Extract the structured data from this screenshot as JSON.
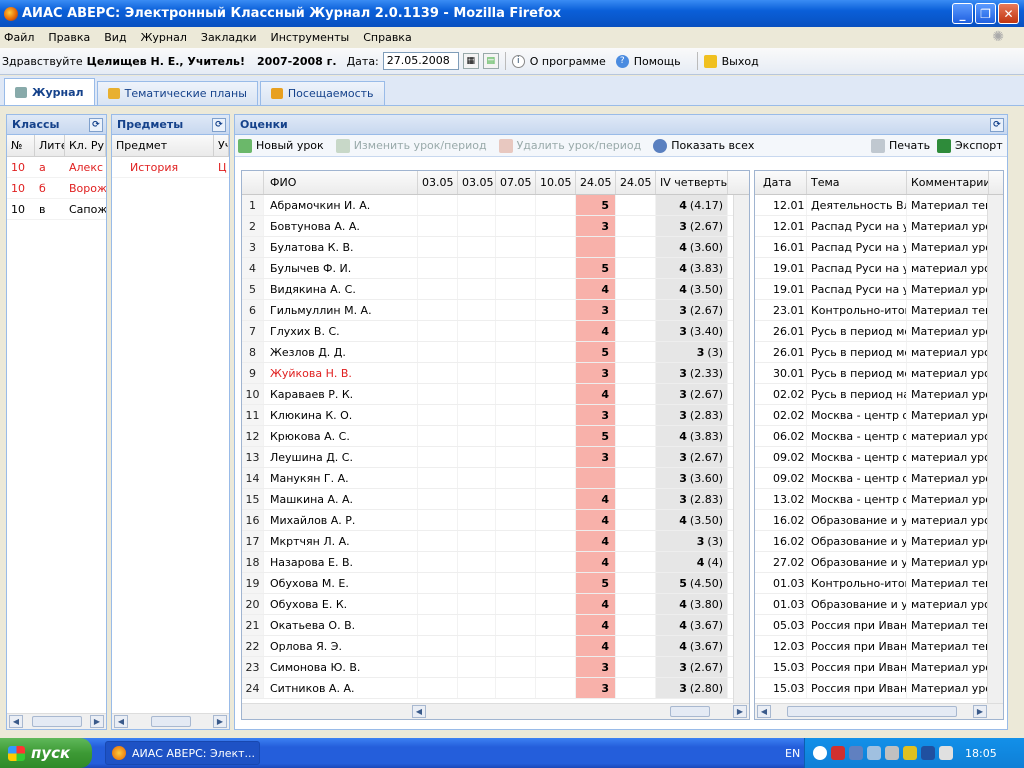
{
  "window": {
    "title": "АИАС АВЕРС: Электронный Классный Журнал 2.0.1139 - Mozilla Firefox"
  },
  "menu": [
    "Файл",
    "Правка",
    "Вид",
    "Журнал",
    "Закладки",
    "Инструменты",
    "Справка"
  ],
  "appbar": {
    "greeting": "Здравствуйте",
    "user": "Целищев Н. Е., Учитель!",
    "year": "2007-2008 г.",
    "date_label": "Дата:",
    "date_value": "27.05.2008",
    "about": "О программе",
    "help": "Помощь",
    "exit": "Выход"
  },
  "tabs": [
    "Журнал",
    "Тематические планы",
    "Посещаемость"
  ],
  "classes": {
    "title": "Классы",
    "headers": [
      "№",
      "Лите",
      "Кл. Ру"
    ],
    "rows": [
      [
        "10",
        "а",
        "Алекс"
      ],
      [
        "10",
        "б",
        "Ворож"
      ],
      [
        "10",
        "в",
        "Сапож"
      ]
    ]
  },
  "subjects": {
    "title": "Предметы",
    "headers": [
      "Предмет",
      "Уч"
    ],
    "rows": [
      [
        "История",
        "Ц"
      ]
    ]
  },
  "grades": {
    "title": "Оценки",
    "toolbar": {
      "new_lesson": "Новый урок",
      "edit_lesson": "Изменить урок/период",
      "delete_lesson": "Удалить урок/период",
      "show_all": "Показать всех",
      "print": "Печать",
      "export": "Экспорт"
    },
    "headers": [
      "ФИО",
      "03.05",
      "03.05",
      "07.05",
      "10.05",
      "24.05",
      "24.05",
      "IV четверть"
    ],
    "rows": [
      [
        "1",
        "Абрамочкин И. А.",
        "5",
        "4",
        "(4.17)"
      ],
      [
        "2",
        "Бовтунова А. А.",
        "3",
        "3",
        "(2.67)"
      ],
      [
        "3",
        "Булатова К. В.",
        "",
        "4",
        "(3.60)"
      ],
      [
        "4",
        "Булычев Ф. И.",
        "5",
        "4",
        "(3.83)"
      ],
      [
        "5",
        "Видякина А. С.",
        "4",
        "4",
        "(3.50)"
      ],
      [
        "6",
        "Гильмуллин М. А.",
        "3",
        "3",
        "(2.67)"
      ],
      [
        "7",
        "Глухих В. С.",
        "4",
        "3",
        "(3.40)"
      ],
      [
        "8",
        "Жезлов Д. Д.",
        "5",
        "3",
        "(3)"
      ],
      [
        "9",
        "Жуйкова Н. В.",
        "3",
        "3",
        "(2.33)"
      ],
      [
        "10",
        "Караваев Р. К.",
        "4",
        "3",
        "(2.67)"
      ],
      [
        "11",
        "Клюкина К. О.",
        "3",
        "3",
        "(2.83)"
      ],
      [
        "12",
        "Крюкова А. С.",
        "5",
        "4",
        "(3.83)"
      ],
      [
        "13",
        "Леушина Д. С.",
        "3",
        "3",
        "(2.67)"
      ],
      [
        "14",
        "Манукян Г. А.",
        "",
        "3",
        "(3.60)"
      ],
      [
        "15",
        "Машкина А. А.",
        "4",
        "3",
        "(2.83)"
      ],
      [
        "16",
        "Михайлов А. Р.",
        "4",
        "4",
        "(3.50)"
      ],
      [
        "17",
        "Мкртчян Л. А.",
        "4",
        "3",
        "(3)"
      ],
      [
        "18",
        "Назарова Е. В.",
        "4",
        "4",
        "(4)"
      ],
      [
        "19",
        "Обухова М. Е.",
        "5",
        "5",
        "(4.50)"
      ],
      [
        "20",
        "Обухова Е. К.",
        "4",
        "4",
        "(3.80)"
      ],
      [
        "21",
        "Окатьева О. В.",
        "4",
        "4",
        "(3.67)"
      ],
      [
        "22",
        "Орлова Я. Э.",
        "4",
        "4",
        "(3.67)"
      ],
      [
        "23",
        "Симонова Ю. В.",
        "3",
        "3",
        "(2.67)"
      ],
      [
        "24",
        "Ситников А. А.",
        "3",
        "3",
        "(2.80)"
      ]
    ]
  },
  "lessons": {
    "headers": [
      "Дата",
      "Тема",
      "Комментарии"
    ],
    "rows": [
      [
        "12.01",
        "Деятельность Вла",
        "Материал темь"
      ],
      [
        "12.01",
        "Распад Руси на уд",
        "Материал урок"
      ],
      [
        "16.01",
        "Распад Руси на уд",
        "Материал урок"
      ],
      [
        "19.01",
        "Распад Руси на уд",
        "материал урок"
      ],
      [
        "19.01",
        "Распад Руси на уд",
        "Материал урок"
      ],
      [
        "23.01",
        "Контрольно-итого",
        "Материал темь"
      ],
      [
        "26.01",
        "Русь в период мон",
        "Материал урок"
      ],
      [
        "26.01",
        "Русь в период мон",
        "материал урок"
      ],
      [
        "30.01",
        "Русь в период мон",
        "материал урок"
      ],
      [
        "02.02",
        "Русь в период нац",
        "Материал урок"
      ],
      [
        "02.02",
        "Москва - центр об",
        "Материал урок"
      ],
      [
        "06.02",
        "Москва - центр об",
        "материал урок"
      ],
      [
        "09.02",
        "Москва - центр об",
        "материал урок"
      ],
      [
        "09.02",
        "Москва - центр об",
        "Материал урок"
      ],
      [
        "13.02",
        "Москва - центр об",
        "Материал урок"
      ],
      [
        "16.02",
        "Образование и укр",
        "материал урок"
      ],
      [
        "16.02",
        "Образование и укр",
        "Материал урок"
      ],
      [
        "27.02",
        "Образование и укр",
        "Материал урок"
      ],
      [
        "01.03",
        "Контрольно-итого",
        "Материал темь"
      ],
      [
        "01.03",
        "Образование и укр",
        "материал урок"
      ],
      [
        "05.03",
        "Россия при Иване I",
        "Материал темь"
      ],
      [
        "12.03",
        "Россия при Иване I",
        "Материал темь"
      ],
      [
        "15.03",
        "Россия при Иване I",
        "Материал урок"
      ],
      [
        "15.03",
        "Россия при Иване I",
        "Материал урок"
      ]
    ]
  },
  "taskbar": {
    "start": "пуск",
    "task": "АИАС АВЕРС: Элект...",
    "lang": "EN",
    "time": "18:05"
  }
}
